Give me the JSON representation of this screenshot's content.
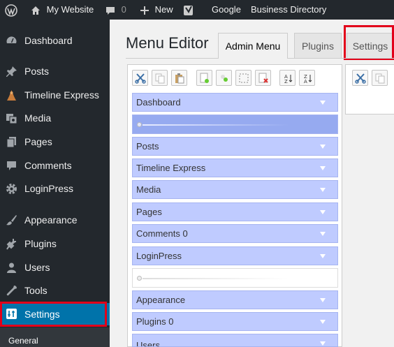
{
  "adminbar": {
    "site_name": "My Website",
    "comments_count": "0",
    "new_label": "New",
    "google_label": "Google",
    "directory_label": "Business Directory",
    "icons": [
      "wordpress-logo-icon",
      "home-icon",
      "comment-icon",
      "plus-icon",
      "yoast-icon"
    ]
  },
  "sidebar": {
    "items": [
      {
        "label": "Dashboard",
        "icon": "dashboard-icon"
      },
      {
        "label": "Posts",
        "icon": "pin-icon"
      },
      {
        "label": "Timeline Express",
        "icon": "timeline-icon"
      },
      {
        "label": "Media",
        "icon": "media-icon"
      },
      {
        "label": "Pages",
        "icon": "pages-icon"
      },
      {
        "label": "Comments",
        "icon": "comments-icon"
      },
      {
        "label": "LoginPress",
        "icon": "gear-icon"
      },
      {
        "label": "Appearance",
        "icon": "brush-icon"
      },
      {
        "label": "Plugins",
        "icon": "plug-icon"
      },
      {
        "label": "Users",
        "icon": "user-icon"
      },
      {
        "label": "Tools",
        "icon": "wrench-icon"
      },
      {
        "label": "Settings",
        "icon": "settings-icon"
      }
    ],
    "submenu_first": "General"
  },
  "page": {
    "title": "Menu Editor",
    "tabs": [
      "Admin Menu",
      "Plugins",
      "Settings"
    ]
  },
  "toolbar": {
    "buttons": [
      "cut-icon",
      "copy-icon",
      "paste-icon",
      "new-menu-icon",
      "new-item-icon",
      "new-separator-icon",
      "delete-icon",
      "sort-asc-icon",
      "sort-desc-icon"
    ]
  },
  "menu": {
    "items": [
      {
        "label": "Dashboard",
        "kind": "item"
      },
      {
        "label": "",
        "kind": "separator-selected"
      },
      {
        "label": "Posts",
        "kind": "item"
      },
      {
        "label": "Timeline Express",
        "kind": "item"
      },
      {
        "label": "Media",
        "kind": "item"
      },
      {
        "label": "Pages",
        "kind": "item"
      },
      {
        "label": "Comments 0",
        "kind": "item"
      },
      {
        "label": "LoginPress",
        "kind": "item"
      },
      {
        "label": "",
        "kind": "separator"
      },
      {
        "label": "Appearance",
        "kind": "item"
      },
      {
        "label": "Plugins 0",
        "kind": "item"
      },
      {
        "label": "Users",
        "kind": "item"
      }
    ]
  },
  "colors": {
    "admin_bar": "#23282d",
    "active_menu": "#0073aa",
    "menu_item_bg": "#bfcbff",
    "highlight_box": "#e2001a"
  }
}
